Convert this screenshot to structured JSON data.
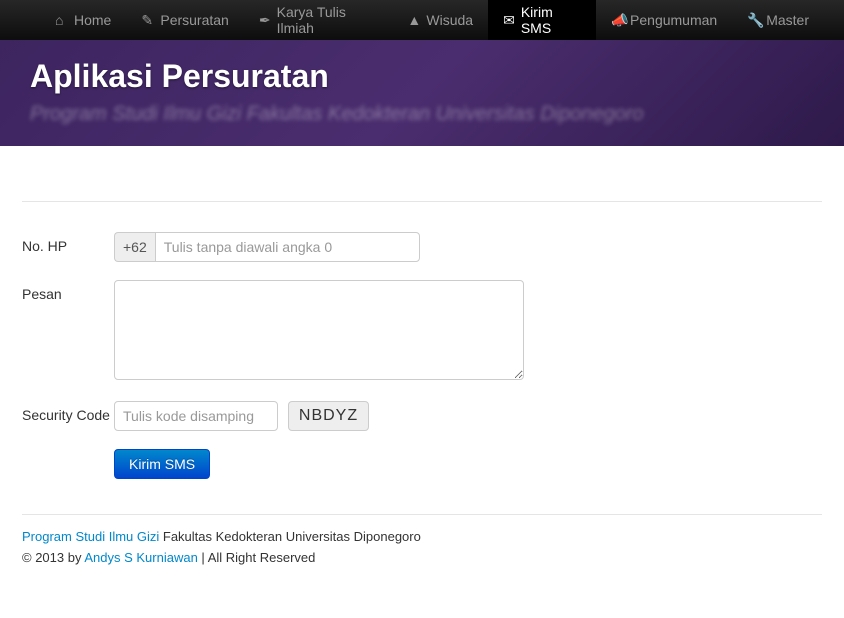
{
  "nav": {
    "items": [
      {
        "label": "Home",
        "icon": "⌂"
      },
      {
        "label": "Persuratan",
        "icon": "✎"
      },
      {
        "label": "Karya Tulis Ilmiah",
        "icon": "✒"
      },
      {
        "label": "Wisuda",
        "icon": "▲"
      },
      {
        "label": "Kirim SMS",
        "icon": "✉",
        "active": true
      },
      {
        "label": "Pengumuman",
        "icon": "📣"
      },
      {
        "label": "Master",
        "icon": "🔧"
      }
    ]
  },
  "banner": {
    "title": "Aplikasi Persuratan",
    "subtitle": "Program Studi Ilmu Gizi Fakultas Kedokteran Universitas Diponegoro"
  },
  "form": {
    "hp_label": "No. HP",
    "hp_prefix": "+62",
    "hp_placeholder": "Tulis tanpa diawali angka 0",
    "hp_value": "",
    "pesan_label": "Pesan",
    "pesan_value": "",
    "security_label": "Security Code",
    "security_placeholder": "Tulis kode disamping",
    "security_value": "",
    "security_code": "NBDYZ",
    "submit_label": "Kirim SMS"
  },
  "footer": {
    "link1": "Program Studi Ilmu Gizi",
    "text1": " Fakultas Kedokteran Universitas Diponegoro",
    "text2a": "© 2013 by ",
    "link2": "Andys S Kurniawan",
    "text2b": " | All Right Reserved"
  }
}
